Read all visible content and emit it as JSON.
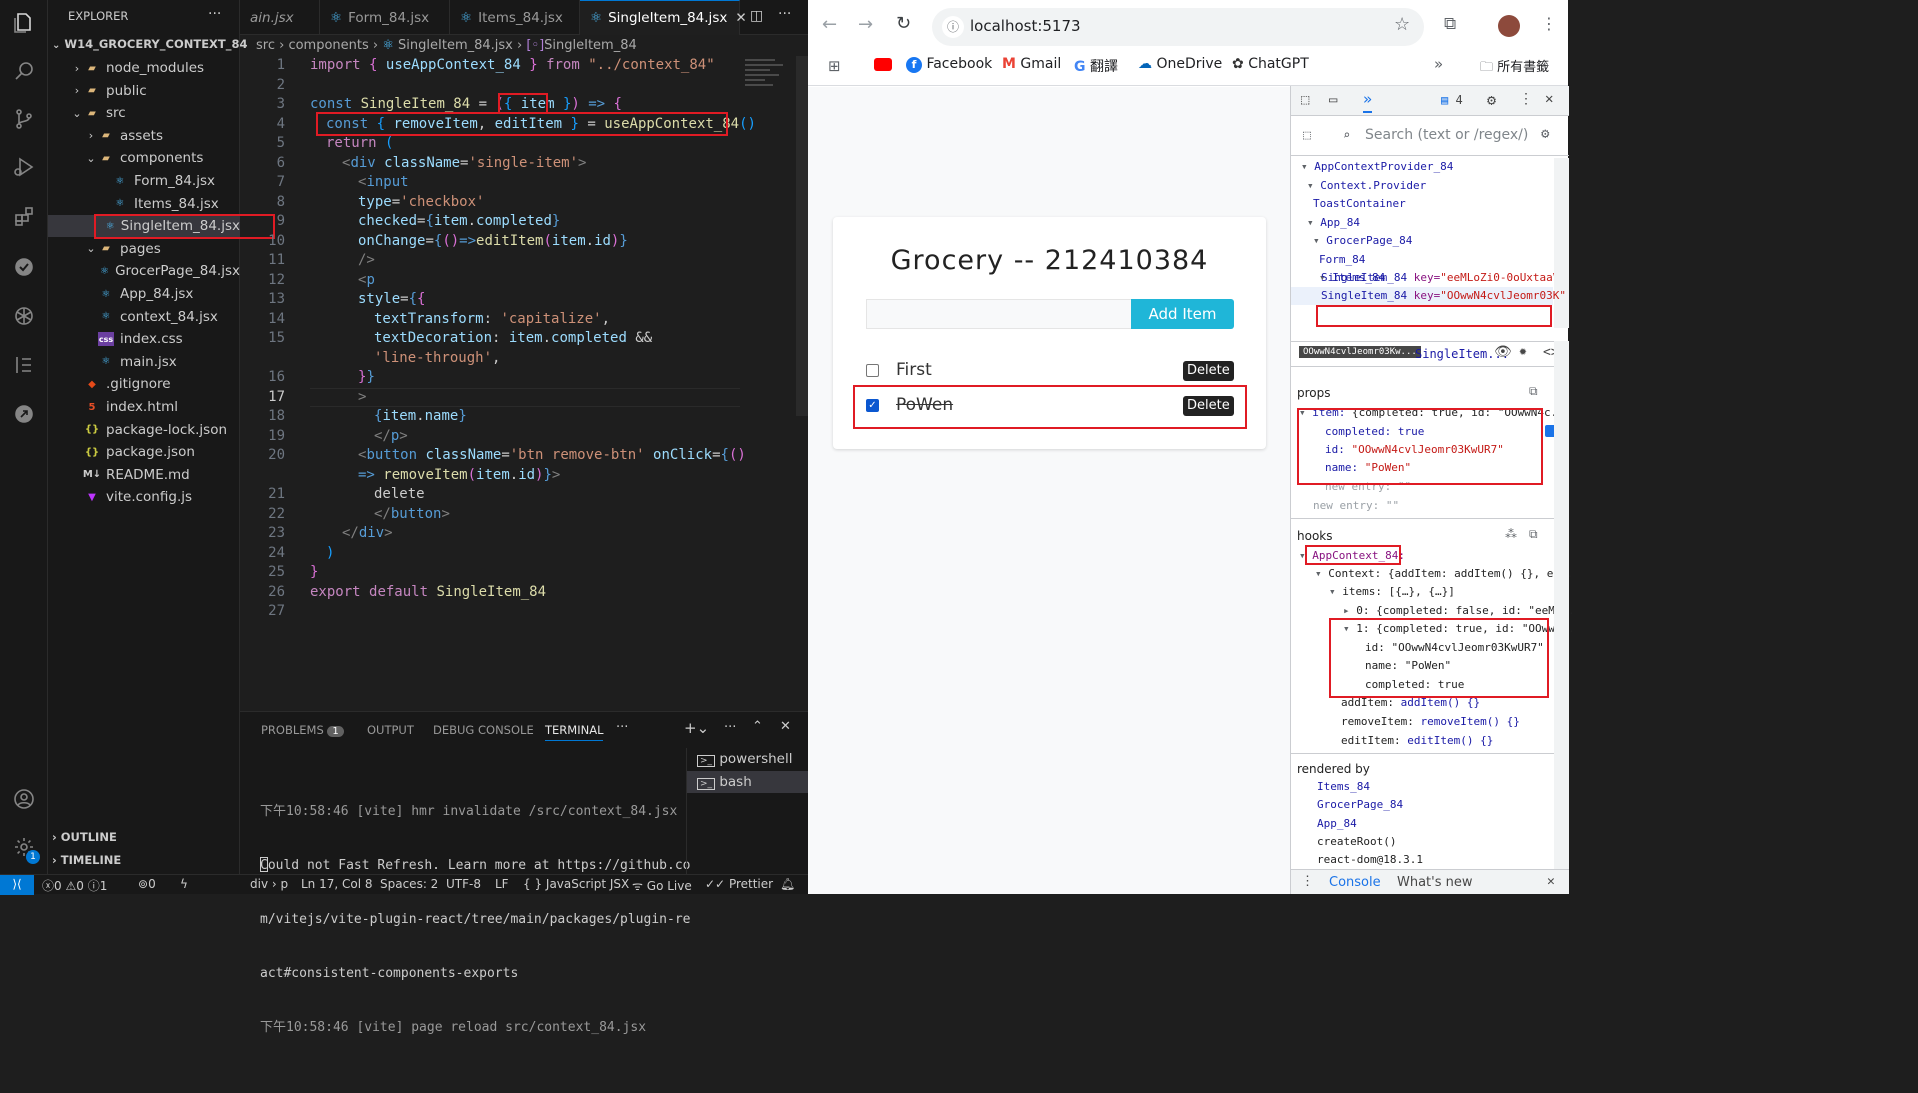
{
  "vscode": {
    "explorer_title": "EXPLORER",
    "project": "W14_GROCERY_CONTEXT_84",
    "tree": [
      {
        "label": "node_modules",
        "level": 1,
        "type": "folder",
        "open": false
      },
      {
        "label": "public",
        "level": 1,
        "type": "folder",
        "open": false
      },
      {
        "label": "src",
        "level": 1,
        "type": "folder",
        "open": true
      },
      {
        "label": "assets",
        "level": 2,
        "type": "folder",
        "open": false
      },
      {
        "label": "components",
        "level": 2,
        "type": "folder",
        "open": true
      },
      {
        "label": "Form_84.jsx",
        "level": 3,
        "type": "react"
      },
      {
        "label": "Items_84.jsx",
        "level": 3,
        "type": "react"
      },
      {
        "label": "SingleItem_84.jsx",
        "level": 3,
        "type": "react",
        "selected": true
      },
      {
        "label": "pages",
        "level": 2,
        "type": "folder",
        "open": true
      },
      {
        "label": "GrocerPage_84.jsx",
        "level": 3,
        "type": "react"
      },
      {
        "label": "App_84.jsx",
        "level": 2,
        "type": "react"
      },
      {
        "label": "context_84.jsx",
        "level": 2,
        "type": "react"
      },
      {
        "label": "index.css",
        "level": 2,
        "type": "css"
      },
      {
        "label": "main.jsx",
        "level": 2,
        "type": "react"
      },
      {
        "label": ".gitignore",
        "level": 1,
        "type": "git"
      },
      {
        "label": "index.html",
        "level": 1,
        "type": "html"
      },
      {
        "label": "package-lock.json",
        "level": 1,
        "type": "json"
      },
      {
        "label": "package.json",
        "level": 1,
        "type": "json"
      },
      {
        "label": "README.md",
        "level": 1,
        "type": "md"
      },
      {
        "label": "vite.config.js",
        "level": 1,
        "type": "vite"
      }
    ],
    "outline": "OUTLINE",
    "timeline": "TIMELINE",
    "tabs": [
      "ain.jsx",
      "Form_84.jsx",
      "Items_84.jsx",
      "SingleItem_84.jsx"
    ],
    "breadcrumb": [
      "src",
      "components",
      "SingleItem_84.jsx",
      "SingleItem_84"
    ],
    "line_numbers": [
      "1",
      "2",
      "3",
      "4",
      "5",
      "6",
      "7",
      "8",
      "9",
      "10",
      "11",
      "12",
      "13",
      "14",
      "15",
      "",
      "16",
      "17",
      "18",
      "19",
      "20",
      "",
      "21",
      "22",
      "23",
      "24",
      "25",
      "26",
      "27"
    ],
    "panel_tabs": [
      "PROBLEMS",
      "OUTPUT",
      "DEBUG CONSOLE",
      "TERMINAL"
    ],
    "problems_count": "1",
    "terminal_lines": [
      "下午10:58:46 [vite] hmr invalidate /src/context_84.jsx",
      "Could not Fast Refresh. Learn more at https://github.co",
      "m/vitejs/vite-plugin-react/tree/main/packages/plugin-re",
      "act#consistent-components-exports",
      "下午10:58:46 [vite] page reload src/context_84.jsx"
    ],
    "terminals": [
      "powershell",
      "bash"
    ],
    "status": {
      "errors": "0",
      "warnings": "0",
      "info": "1",
      "ports": "0",
      "position": "div › p",
      "lncol": "Ln 17, Col 8",
      "spaces": "Spaces: 2",
      "encoding": "UTF-8",
      "eol": "LF",
      "language": "JavaScript JSX",
      "golive": "Go Live",
      "prettier": "Prettier"
    }
  },
  "chrome": {
    "url": "localhost:5173",
    "bookmarks": [
      "Facebook",
      "Gmail",
      "翻譯",
      "OneDrive",
      "ChatGPT"
    ],
    "all_bookmarks": "所有書籤"
  },
  "app": {
    "title": "Grocery -- 212410384",
    "input_value": "",
    "add_button": "Add Item",
    "items": [
      {
        "name": "First",
        "completed": false,
        "delete": "Delete"
      },
      {
        "name": "PoWen",
        "completed": true,
        "delete": "Delete"
      }
    ]
  },
  "devtools": {
    "search_placeholder": "Search (text or /regex/)",
    "issues_count": "4",
    "tree": [
      {
        "label": "AppContextProvider_84",
        "indent": 0,
        "arrow": "▾"
      },
      {
        "label": "Context.Provider",
        "indent": 1,
        "arrow": "▾"
      },
      {
        "label": "ToastContainer",
        "indent": 2,
        "arrow": ""
      },
      {
        "label": "App_84",
        "indent": 1,
        "arrow": "▾"
      },
      {
        "label": "GrocerPage_84",
        "indent": 2,
        "arrow": "▾"
      },
      {
        "label": "Form_84",
        "indent": 3,
        "arrow": ""
      },
      {
        "label": "Items_84",
        "indent": 3,
        "arrow": "▾"
      }
    ],
    "single_rows": [
      {
        "name": "SingleItem_84",
        "key_label": "key=",
        "key_val": "\"eeMLoZi0-0oUxtaaV\""
      },
      {
        "name": "SingleItem_84",
        "key_label": "key=",
        "key_val": "\"OOwwN4cvlJeomr03K\""
      }
    ],
    "selected_key": "OOwwN4cvlJeomr03Kw...",
    "selected_comp": "SingleItem...",
    "props_title": "props",
    "props": {
      "item_label": "item:",
      "item_summary": "{completed: true, id: \"OOwwN4c...",
      "completed_key": "completed:",
      "completed_val": "true",
      "id_key": "id:",
      "id_val": "\"OOwwN4cvlJeomr03KwUR7\"",
      "name_key": "name:",
      "name_val": "\"PoWen\"",
      "new_entry1": "new entry: \"\"",
      "new_entry2": "new entry: \"\""
    },
    "hooks_title": "hooks",
    "hooks": {
      "ctx_name": "AppContext_84:",
      "context": "Context: {addItem: addItem() {}, e...",
      "items": "items: [{…}, {…}]",
      "item0": "0: {completed: false, id: \"eeM...",
      "item1": "1: {completed: true, id: \"OOww...",
      "id_line": "id: \"OOwwN4cvlJeomr03KwUR7\"",
      "name_line": "name: \"PoWen\"",
      "completed_line": "completed: true",
      "addItem": "addItem:",
      "addItem_val": "addItem() {}",
      "removeItem": "removeItem:",
      "removeItem_val": "removeItem() {}",
      "editItem": "editItem:",
      "editItem_val": "editItem() {}"
    },
    "rendered_by_title": "rendered by",
    "rendered_by": [
      "Items_84",
      "GrocerPage_84",
      "App_84",
      "createRoot()",
      "react-dom@18.3.1"
    ],
    "drawer_tabs": [
      "Console",
      "What's new"
    ]
  },
  "colors": {
    "highlight_red": "#e01b24",
    "vscode_accent": "#0078d4",
    "add_button": "#1fb6d8"
  }
}
